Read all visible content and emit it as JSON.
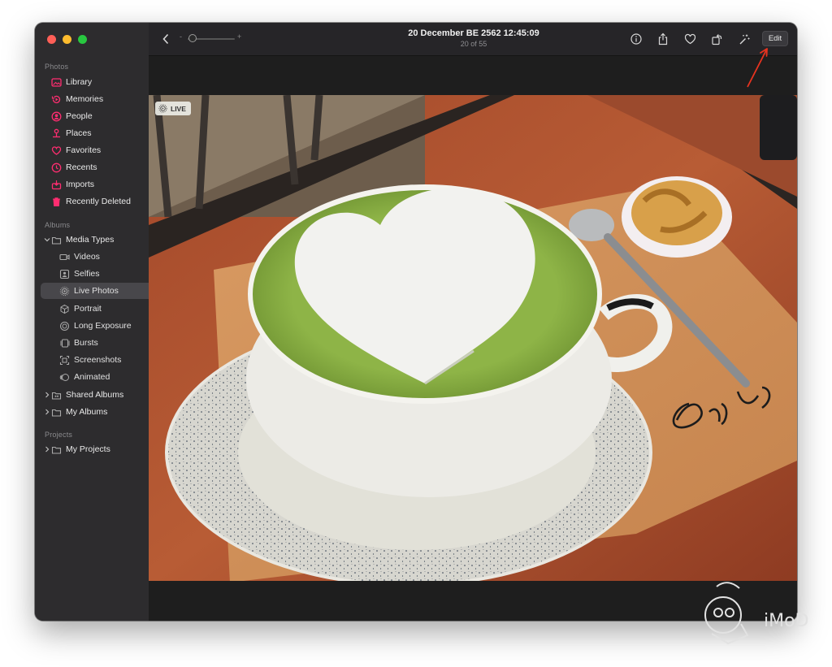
{
  "window": {
    "title": "20 December BE 2562 12:45:09",
    "subtitle": "20 of 55"
  },
  "sidebar": {
    "sections": [
      {
        "title": "Photos",
        "items": [
          {
            "label": "Library",
            "icon": "library-icon"
          },
          {
            "label": "Memories",
            "icon": "memories-icon"
          },
          {
            "label": "People",
            "icon": "people-icon"
          },
          {
            "label": "Places",
            "icon": "places-icon"
          },
          {
            "label": "Favorites",
            "icon": "heart-icon"
          },
          {
            "label": "Recents",
            "icon": "clock-icon"
          },
          {
            "label": "Imports",
            "icon": "imports-icon"
          },
          {
            "label": "Recently Deleted",
            "icon": "trash-icon"
          }
        ]
      },
      {
        "title": "Albums",
        "items": [
          {
            "label": "Media Types",
            "icon": "folder-icon",
            "expanded": true
          },
          {
            "label": "Videos",
            "icon": "video-icon"
          },
          {
            "label": "Selfies",
            "icon": "selfie-icon"
          },
          {
            "label": "Live Photos",
            "icon": "live-photo-icon",
            "selected": true
          },
          {
            "label": "Portrait",
            "icon": "cube-icon"
          },
          {
            "label": "Long Exposure",
            "icon": "long-exposure-icon"
          },
          {
            "label": "Bursts",
            "icon": "bursts-icon"
          },
          {
            "label": "Screenshots",
            "icon": "screenshot-icon"
          },
          {
            "label": "Animated",
            "icon": "animated-icon"
          },
          {
            "label": "Shared Albums",
            "icon": "shared-folder-icon",
            "expanded": false
          },
          {
            "label": "My Albums",
            "icon": "folder-icon",
            "expanded": false
          }
        ]
      },
      {
        "title": "Projects",
        "items": [
          {
            "label": "My Projects",
            "icon": "folder-icon",
            "expanded": false
          }
        ]
      }
    ]
  },
  "toolbar": {
    "zoom_minus": "-",
    "zoom_plus": "+",
    "edit_label": "Edit"
  },
  "photo": {
    "badge": "LIVE",
    "handwriting": "enjoy"
  },
  "watermark": {
    "text": "iMoD"
  },
  "colors": {
    "accent": "#ff2d70",
    "sidebar_bg": "#2d2c2e",
    "selected_bg": "#48474b",
    "annotation_arrow": "#e8331f"
  }
}
